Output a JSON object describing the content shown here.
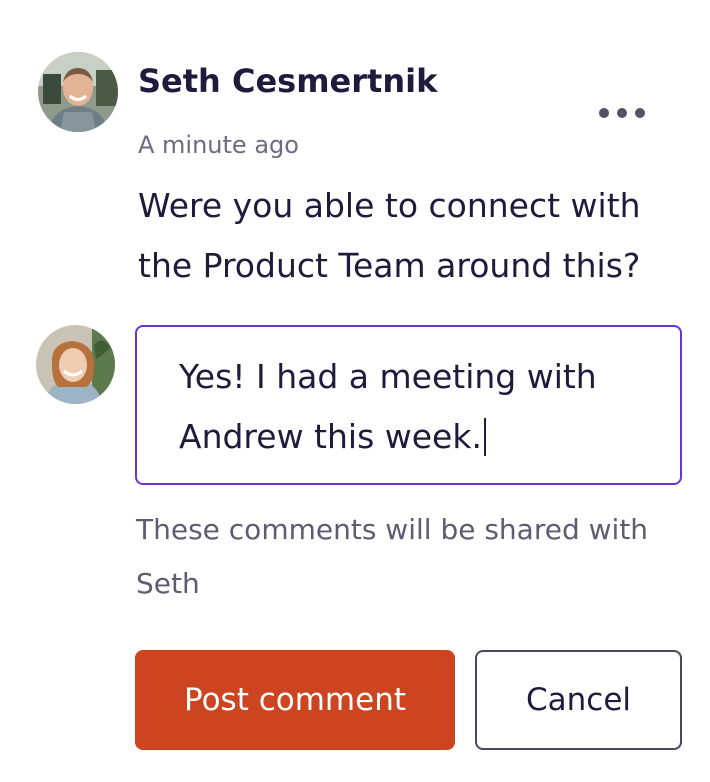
{
  "comment": {
    "author_name": "Seth Cesmertnik",
    "timestamp": "A minute ago",
    "text": "Were you able to connect with the Product Team around this?"
  },
  "reply": {
    "value": "Yes! I had a meeting with Andrew this week."
  },
  "share_note": "These comments will be shared with Seth",
  "actions": {
    "post_label": "Post comment",
    "cancel_label": "Cancel"
  },
  "icons": {
    "more": "more-horizontal-icon"
  },
  "colors": {
    "accent_border": "#6a35c9",
    "primary_button": "#cc4420",
    "text_dark": "#1f1b3d",
    "text_muted": "#6e6b80"
  }
}
